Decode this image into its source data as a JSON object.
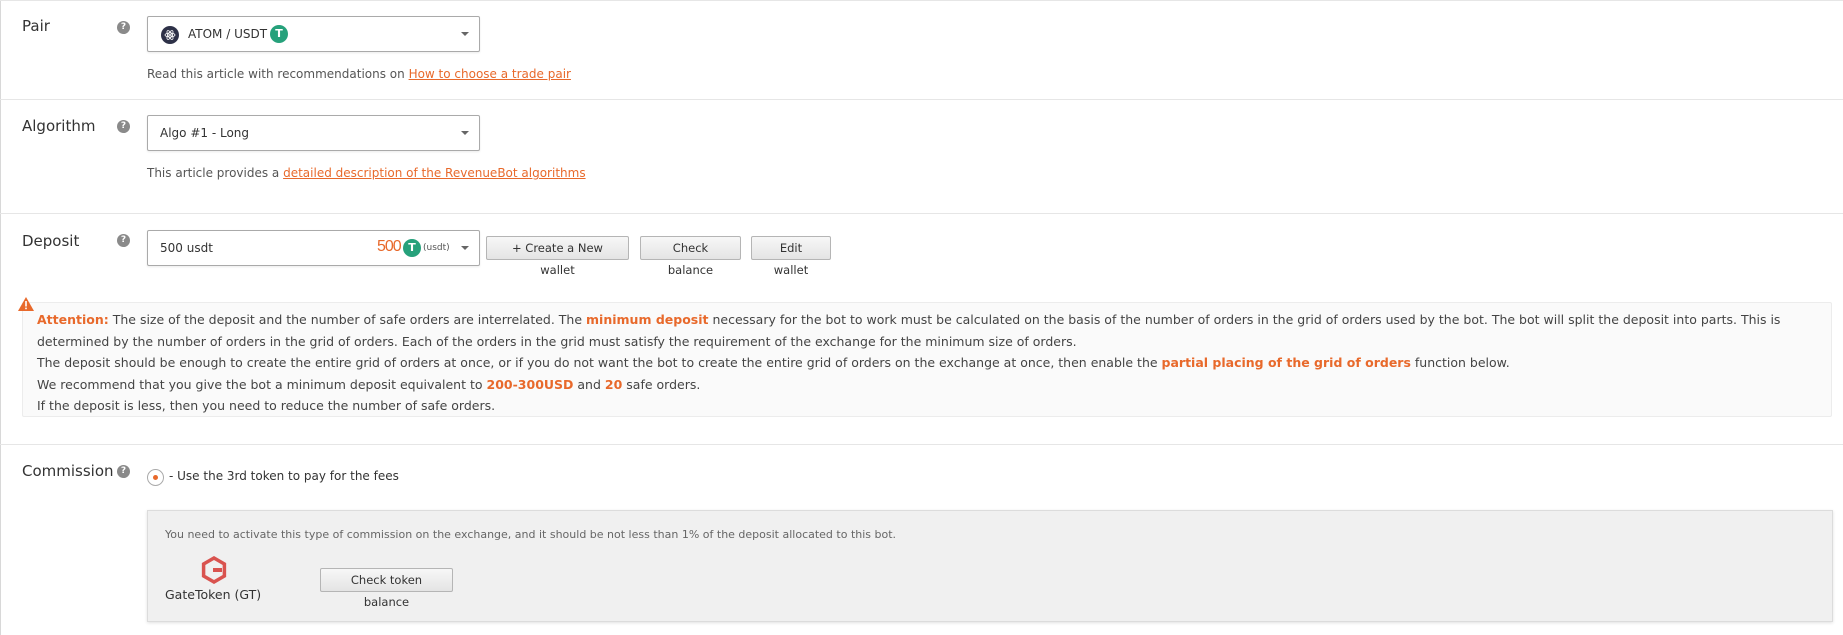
{
  "pair": {
    "label": "Pair",
    "help_glyph": "?",
    "selected": "ATOM / USDT",
    "tether_glyph": "T",
    "note_prefix": "Read this article with recommendations on ",
    "note_link": "How to choose a trade pair"
  },
  "algorithm": {
    "label": "Algorithm",
    "help_glyph": "?",
    "selected": "Algo #1 - Long",
    "note_prefix": "This article provides a ",
    "note_link": "detailed description of the RevenueBot algorithms"
  },
  "deposit": {
    "label": "Deposit",
    "help_glyph": "?",
    "selected": "500 usdt",
    "amount": "500",
    "tether_glyph": "T",
    "currency_tag": "(usdt)",
    "buttons": {
      "create_wallet": "+ Create a New wallet",
      "check_balance": "Check balance",
      "edit_wallet": "Edit wallet"
    }
  },
  "attention": {
    "title": "Attention:",
    "p1_a": " The size of the deposit and the number of safe orders are interrelated. The ",
    "p1_hl": "minimum deposit",
    "p1_b": " necessary for the bot to work must be calculated on the basis of the number of orders in the grid of orders used by the bot. The bot will split the deposit into parts. This is determined by the number of orders in the grid of orders. Each of the orders in the grid must satisfy the requirement of the exchange for the minimum size of orders.",
    "p2_a": "The deposit should be enough to create the entire grid of orders at once, or if you do not want the bot to create the entire grid of orders on the exchange at once, then enable the ",
    "p2_hl": "partial placing of the grid of orders",
    "p2_b": " function below.",
    "p3_a": "We recommend that you give the bot a minimum deposit equivalent to ",
    "p3_hl1": "200-300USD",
    "p3_mid": " and ",
    "p3_hl2": "20",
    "p3_b": " safe orders.",
    "p4": "If the deposit is less, then you need to reduce the number of safe orders."
  },
  "commission": {
    "label": "Commission",
    "help_glyph": "?",
    "radio_label": "- Use the 3rd token to pay for the fees",
    "panel_text": "You need to activate this type of commission on the exchange, and it should be not less than 1% of the deposit allocated to this bot.",
    "token_name": "GateToken (GT)",
    "check_token_button": "Check token balance"
  },
  "colors": {
    "accent": "#e8692b",
    "tether": "#26a17b",
    "gate_logo": "#d9534f"
  }
}
